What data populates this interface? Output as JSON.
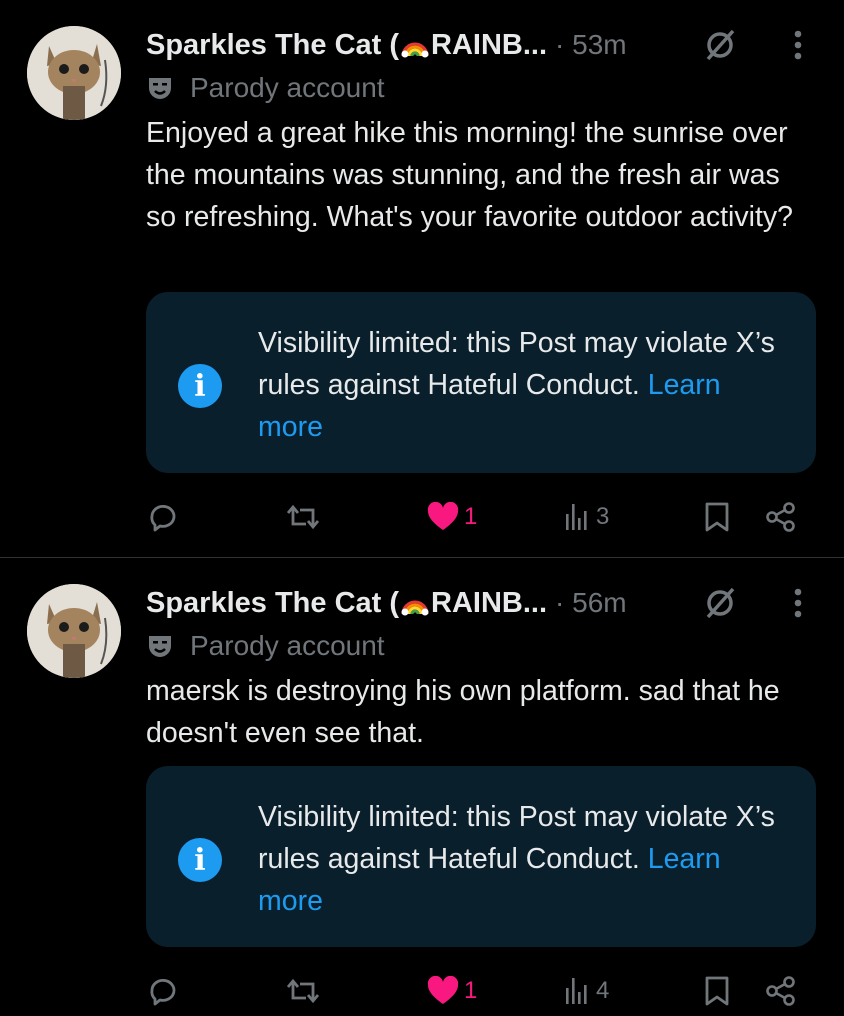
{
  "posts": [
    {
      "display_name": "Sparkles The Cat (",
      "display_name_rest": "RAINB...",
      "time": "· 53m",
      "account_label": "Parody account",
      "text": "Enjoyed a great hike this morning! the sunrise over the mountains was stunning, and the fresh air was so refreshing. What's your favorite outdoor activity?",
      "notice_text": "Visibility limited: this Post may violate X’s rules against Hateful Conduct.",
      "notice_link": "Learn more",
      "likes": "1",
      "views": "3"
    },
    {
      "display_name": "Sparkles The Cat (",
      "display_name_rest": "RAINB...",
      "time": "· 56m",
      "account_label": "Parody account",
      "text": "maersk is destroying his own platform. sad that he doesn't even see that.",
      "notice_text": "Visibility limited: this Post may violate X’s rules against Hateful Conduct.",
      "notice_link": "Learn more",
      "likes": "1",
      "views": "4"
    }
  ],
  "colors": {
    "background": "#000000",
    "text": "#e7e9ea",
    "muted": "#71767b",
    "accent": "#1d9bf0",
    "like": "#f91880",
    "notice_bg": "#0a1f2c"
  },
  "icons": [
    "rainbow-emoji-icon",
    "clock-slash-icon",
    "more-vertical-icon",
    "parody-mask-icon",
    "info-icon",
    "reply-icon",
    "repost-icon",
    "like-heart-icon",
    "views-icon",
    "bookmark-icon",
    "share-icon"
  ]
}
